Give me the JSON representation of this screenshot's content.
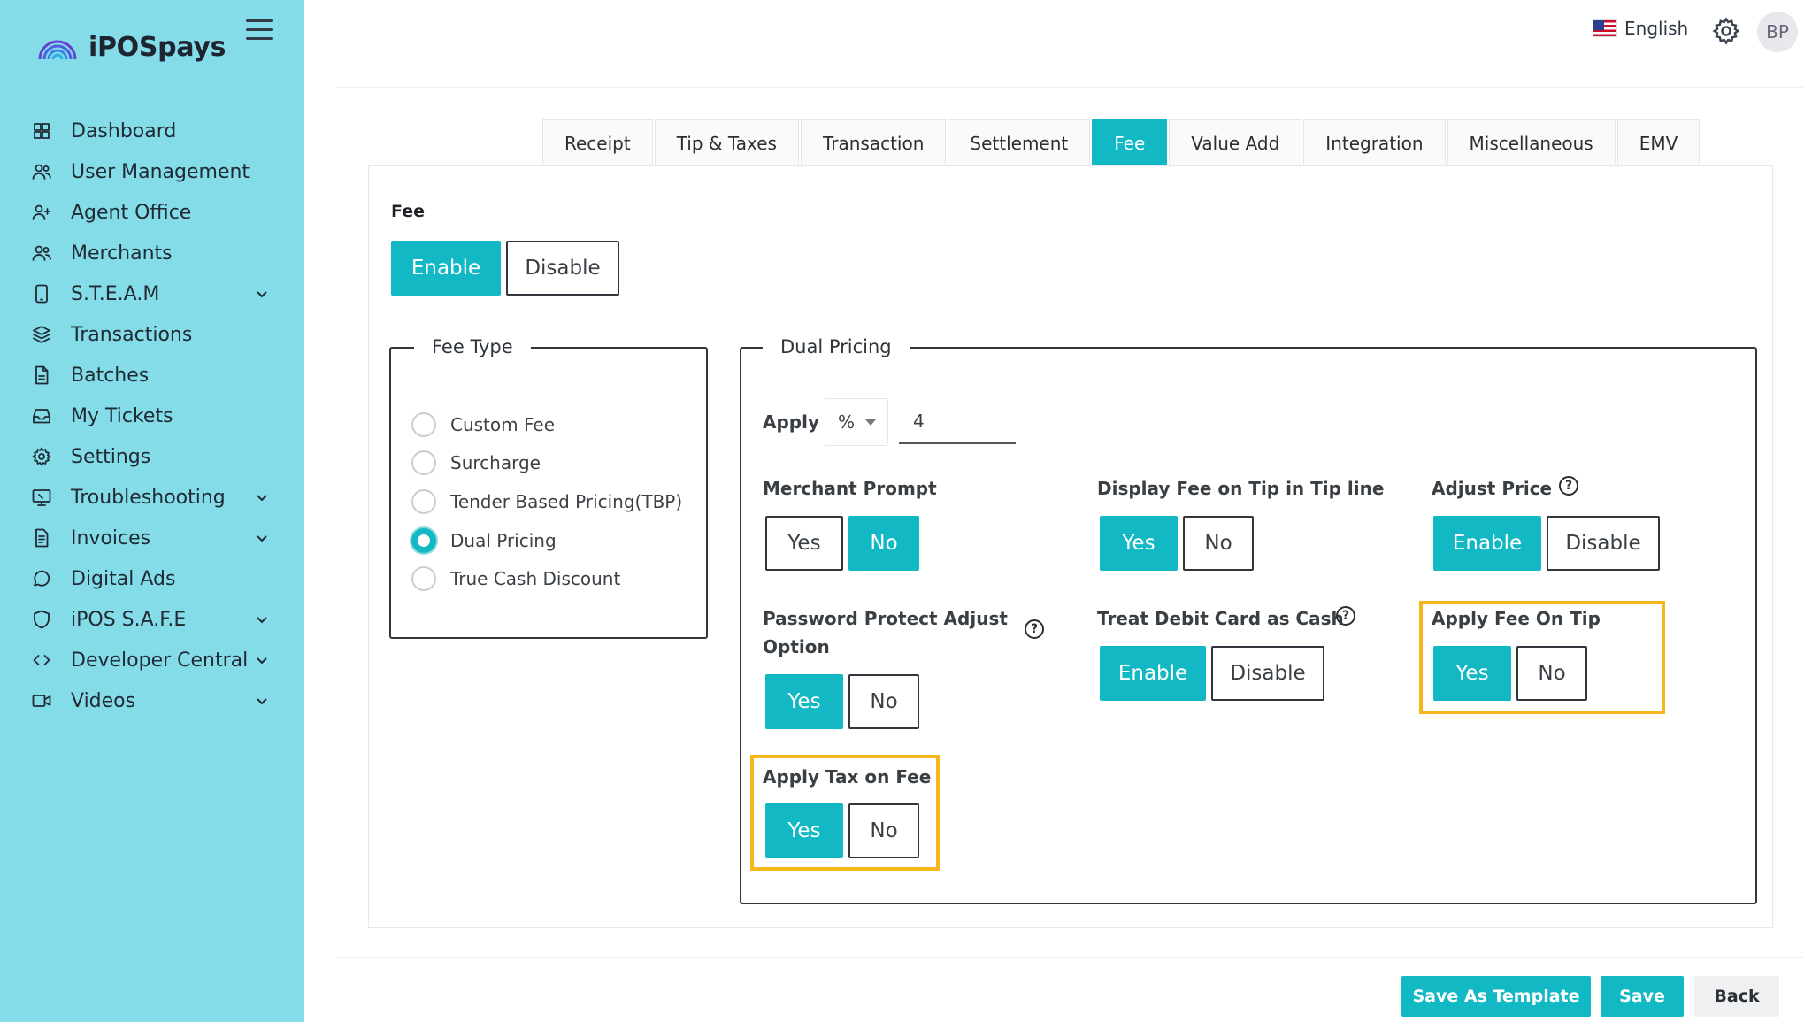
{
  "app": {
    "brand": "iPOSpays"
  },
  "sidebar": {
    "items": [
      {
        "label": "Dashboard",
        "icon": "grid-icon",
        "expandable": false
      },
      {
        "label": "User Management",
        "icon": "users-icon",
        "expandable": false
      },
      {
        "label": "Agent Office",
        "icon": "user-plus-icon",
        "expandable": false
      },
      {
        "label": "Merchants",
        "icon": "users-icon",
        "expandable": false
      },
      {
        "label": "S.T.E.A.M",
        "icon": "tablet-icon",
        "expandable": true
      },
      {
        "label": "Transactions",
        "icon": "layers-icon",
        "expandable": false
      },
      {
        "label": "Batches",
        "icon": "file-icon",
        "expandable": false
      },
      {
        "label": "My Tickets",
        "icon": "inbox-icon",
        "expandable": false
      },
      {
        "label": "Settings",
        "icon": "gear-icon",
        "expandable": false
      },
      {
        "label": "Troubleshooting",
        "icon": "monitor-icon",
        "expandable": true
      },
      {
        "label": "Invoices",
        "icon": "document-icon",
        "expandable": true
      },
      {
        "label": "Digital Ads",
        "icon": "chat-icon",
        "expandable": false
      },
      {
        "label": "iPOS S.A.F.E",
        "icon": "shield-icon",
        "expandable": true
      },
      {
        "label": "Developer Central",
        "icon": "code-icon",
        "expandable": true
      },
      {
        "label": "Videos",
        "icon": "video-icon",
        "expandable": true
      }
    ]
  },
  "header": {
    "language": "English",
    "avatar_initials": "BP"
  },
  "tabs": {
    "items": [
      "Receipt",
      "Tip & Taxes",
      "Transaction",
      "Settlement",
      "Fee",
      "Value Add",
      "Integration",
      "Miscellaneous",
      "EMV"
    ],
    "active": "Fee"
  },
  "fee": {
    "title": "Fee",
    "enable_label": "Enable",
    "disable_label": "Disable",
    "selected": "Enable"
  },
  "fee_type": {
    "legend": "Fee Type",
    "options": [
      "Custom Fee",
      "Surcharge",
      "Tender Based Pricing(TBP)",
      "Dual Pricing",
      "True Cash Discount"
    ],
    "selected": "Dual Pricing"
  },
  "dual_pricing": {
    "legend": "Dual Pricing",
    "apply_label": "Apply",
    "apply_unit": "%",
    "apply_value": "4",
    "merchant_prompt": {
      "label": "Merchant Prompt",
      "yes": "Yes",
      "no": "No",
      "selected": "No"
    },
    "display_fee_on_tip": {
      "label": "Display Fee on Tip in Tip line",
      "yes": "Yes",
      "no": "No",
      "selected": "Yes"
    },
    "adjust_price": {
      "label": "Adjust Price",
      "enable": "Enable",
      "disable": "Disable",
      "selected": "Enable"
    },
    "password_protect": {
      "label_line1": "Password Protect Adjust",
      "label_line2": "Option",
      "yes": "Yes",
      "no": "No",
      "selected": "Yes"
    },
    "treat_debit_as_cash": {
      "label": "Treat Debit Card as Cash",
      "enable": "Enable",
      "disable": "Disable",
      "selected": "Enable"
    },
    "apply_fee_on_tip": {
      "label": "Apply Fee On Tip",
      "yes": "Yes",
      "no": "No",
      "selected": "Yes"
    },
    "apply_tax_on_fee": {
      "label": "Apply Tax on Fee",
      "yes": "Yes",
      "no": "No",
      "selected": "Yes"
    },
    "help_glyph": "?"
  },
  "footer": {
    "save_as_template": "Save As Template",
    "save": "Save",
    "back": "Back"
  },
  "colors": {
    "accent": "#12b9c4",
    "sidebar": "#84dce9",
    "highlight": "#f5b61c"
  }
}
